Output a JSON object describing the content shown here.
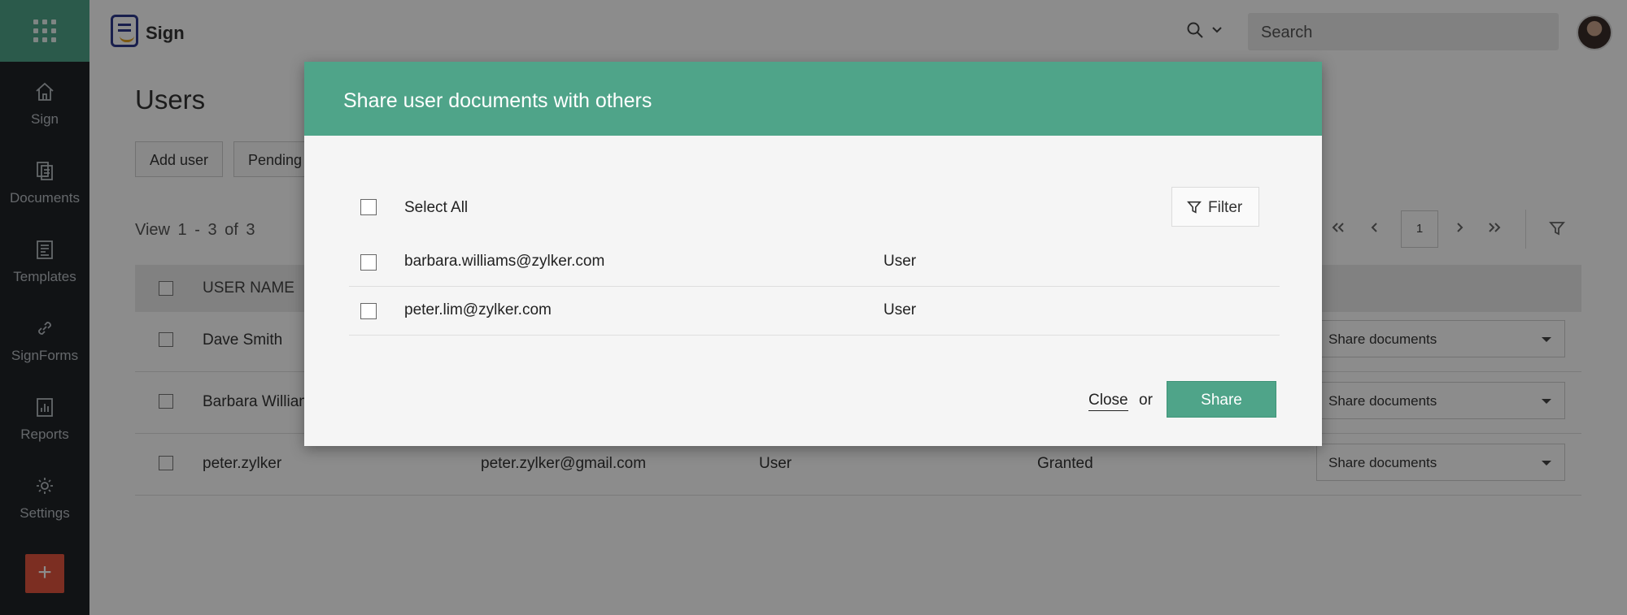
{
  "app": {
    "name": "Sign"
  },
  "colors": {
    "brand_green": "#4fa489",
    "sidebar_bg": "#1f2327",
    "add_button": "#e2553f"
  },
  "sidebar": {
    "items": [
      {
        "label": "Sign",
        "icon": "home-icon"
      },
      {
        "label": "Documents",
        "icon": "documents-icon"
      },
      {
        "label": "Templates",
        "icon": "templates-icon"
      },
      {
        "label": "SignForms",
        "icon": "link-icon"
      },
      {
        "label": "Reports",
        "icon": "reports-icon"
      },
      {
        "label": "Settings",
        "icon": "gear-icon"
      }
    ],
    "add_label": "+"
  },
  "header": {
    "search_placeholder": "Search"
  },
  "main": {
    "title": "Users",
    "buttons": {
      "add_user": "Add user",
      "pending": "Pending"
    },
    "view_count": "View 1 - 3 of 3",
    "pager": {
      "current_page": "1"
    },
    "table": {
      "header_user_name": "USER NAME",
      "rows": [
        {
          "name": "Dave Smith",
          "email": "",
          "role": "",
          "status": "",
          "action": "Share documents"
        },
        {
          "name": "Barbara William",
          "email": "",
          "role": "",
          "status": "",
          "action": "Share documents"
        },
        {
          "name": "peter.zylker",
          "email": "peter.zylker@gmail.com",
          "role": "User",
          "status": "Granted",
          "action": "Share documents"
        }
      ]
    }
  },
  "modal": {
    "title": "Share user documents with others",
    "select_all": "Select All",
    "filter_label": "Filter",
    "users": [
      {
        "email": "barbara.williams@zylker.com",
        "role": "User"
      },
      {
        "email": "peter.lim@zylker.com",
        "role": "User"
      }
    ],
    "close_label": "Close",
    "or_label": "or",
    "share_label": "Share"
  }
}
